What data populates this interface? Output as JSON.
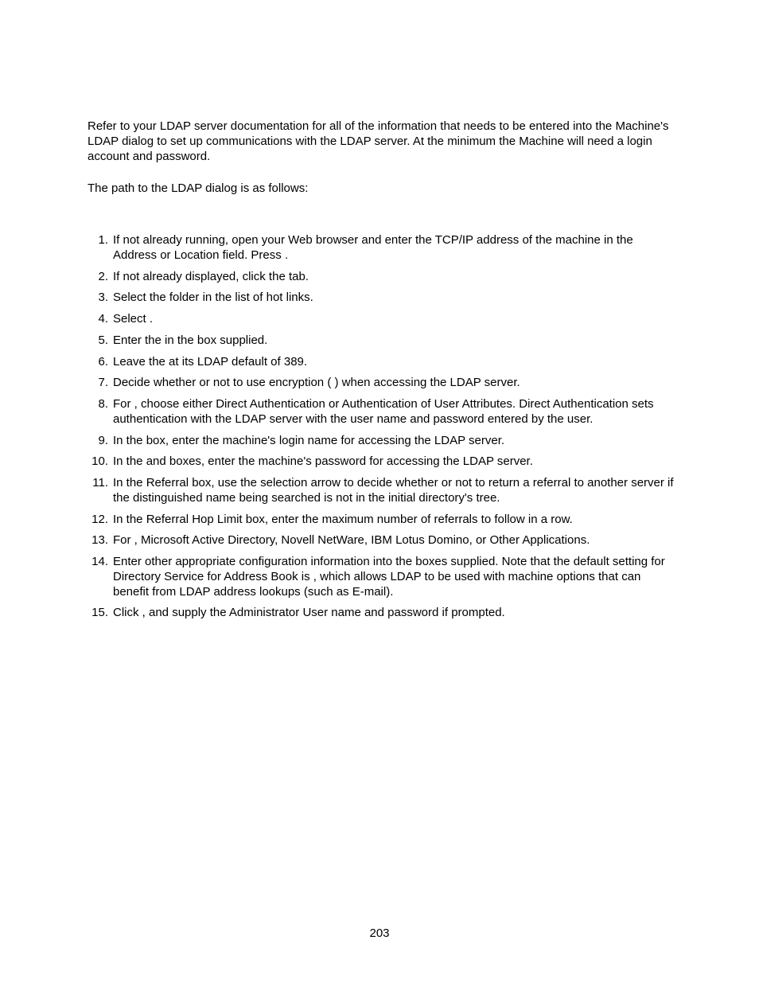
{
  "intro": "Refer to your LDAP server documentation for all of the information that needs to be entered into the Machine's LDAP dialog to set up communications with the LDAP server.  At the minimum the Machine will need a login account and password.",
  "path_line": "The path to the LDAP dialog is as follows:",
  "steps": [
    {
      "n": "1.",
      "text": "If not already running, open your Web browser and enter the TCP/IP address of the machine in the Address or Location field. Press            ."
    },
    {
      "n": "2.",
      "text": "If not already displayed, click the                               tab."
    },
    {
      "n": "3.",
      "text": "Select the                                                                                                folder in the list of hot links."
    },
    {
      "n": "4.",
      "text": "Select                                                                  ."
    },
    {
      "n": "5.",
      "text": "Enter the                                                                                     in the box supplied."
    },
    {
      "n": "6.",
      "text": "Leave the                                                             at its LDAP default of 389."
    },
    {
      "n": "7.",
      "text": "Decide whether or not to use encryption (                                                       ) when accessing the LDAP server."
    },
    {
      "n": "8.",
      "text": "For                                            , choose either Direct Authentication or Authentication of User Attributes.  Direct Authentication sets authentication with the LDAP server with the user name and password entered by the user."
    },
    {
      "n": "9.",
      "text": "In the                                       box, enter the machine's login name for accessing the LDAP server."
    },
    {
      "n": "10.",
      "text": "In the                                  and                                                 boxes, enter the machine's password for accessing the LDAP server."
    },
    {
      "n": "11.",
      "text": "In the Referral box, use the selection arrow to decide whether or not to return a referral to another server if the distinguished name being searched is not in the initial directory's tree."
    },
    {
      "n": "12.",
      "text": "In the Referral Hop Limit box, enter the maximum number of referrals to follow in a row."
    },
    {
      "n": "13.",
      "text": "For                                       , Microsoft Active Directory, Novell NetWare, IBM Lotus Domino, or Other Applications."
    },
    {
      "n": "14.",
      "text": "Enter other appropriate configuration information into the boxes supplied.  Note that the default setting for Directory Service for Address Book is         , which allows LDAP to be used with machine options that can benefit from LDAP address lookups (such as E-mail)."
    },
    {
      "n": "15.",
      "text": "Click           , and supply the Administrator User name and password if prompted."
    }
  ],
  "page_number": "203"
}
